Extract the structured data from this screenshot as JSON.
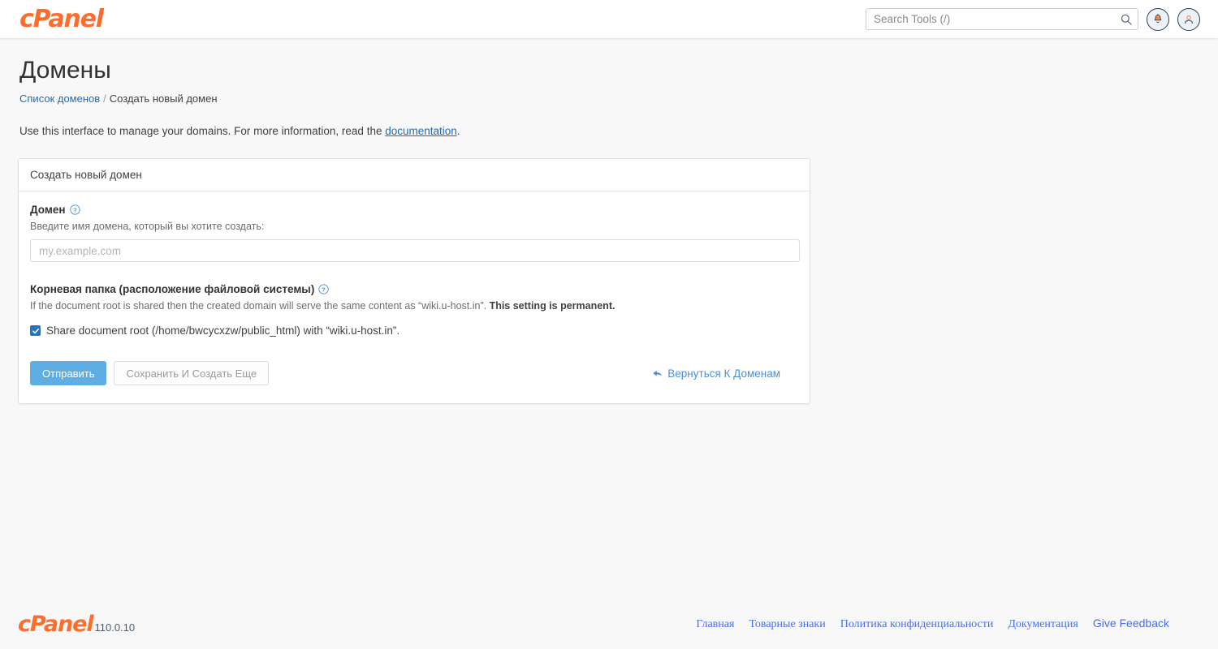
{
  "header": {
    "brand": "cPanel",
    "search": {
      "placeholder": "Search Tools (/)",
      "value": "",
      "icon": "search-icon"
    },
    "notifications_icon": "bell-icon",
    "account_icon": "user-icon"
  },
  "page": {
    "title": "Домены",
    "breadcrumb": {
      "parent": "Список доменов",
      "separator": "/",
      "current": "Создать новый домен"
    },
    "intro": {
      "before": "Use this interface to manage your domains. For more information, read the ",
      "link": "documentation",
      "after": "."
    }
  },
  "panel": {
    "heading": "Создать новый домен",
    "domain_field": {
      "label": "Домен",
      "help_icon": "help-circle-icon",
      "hint": "Введите имя домена, который вы хотите создать:",
      "placeholder": "my.example.com",
      "value": ""
    },
    "docroot_field": {
      "label": "Корневая папка (расположение файловой системы)",
      "help_icon": "help-circle-icon",
      "hint_before": "If the document root is shared then the created domain will serve the same content as “wiki.u-host.in”. ",
      "hint_bold": "This setting is permanent.",
      "checkbox_checked": true,
      "checkbox_label": "Share document root (/home/bwcycxzw/public_html) with “wiki.u-host.in”."
    },
    "actions": {
      "submit_label": "Отправить",
      "save_and_create_label": "Сохранить И Создать Еще",
      "back_label": "Вернуться К Доменам",
      "back_icon": "back-arrow-icon"
    }
  },
  "footer": {
    "brand": "cPanel",
    "version": "110.0.10",
    "links": [
      {
        "label": "Главная",
        "style": "serif"
      },
      {
        "label": "Товарные знаки",
        "style": "serif"
      },
      {
        "label": "Политика конфиденциальности",
        "style": "serif"
      },
      {
        "label": "Документация",
        "style": "serif"
      },
      {
        "label": "Give Feedback",
        "style": "sans"
      }
    ]
  },
  "colors": {
    "brand_orange": "#ff6c2c",
    "link_blue": "#1e6bb8",
    "primary_button": "#5faee3",
    "checkbox_blue": "#2274c4",
    "page_background": "#f8f8f8"
  }
}
